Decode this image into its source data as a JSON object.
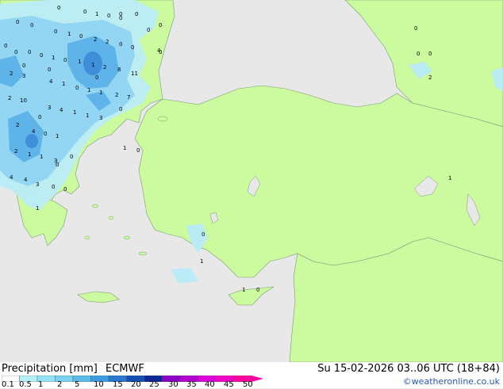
{
  "footer": {
    "title": "Precipitation [mm]",
    "model": "ECMWF",
    "datetime": "Su 15-02-2026 03..06 UTC (18+84)",
    "credit": "©weatheronline.co.uk"
  },
  "scale": {
    "ticks": [
      "0.1",
      "0.5",
      "1",
      "2",
      "5",
      "10",
      "15",
      "20",
      "25",
      "30",
      "35",
      "40",
      "45",
      "50"
    ],
    "colors": [
      "#ffffff",
      "#b4f0f8",
      "#96e2f5",
      "#78d2f0",
      "#5abbe8",
      "#3c9ee0",
      "#2878d2",
      "#1450b4",
      "#0a2896",
      "#8c00c8",
      "#b400d2",
      "#dc00dc",
      "#f000c8",
      "#ff00a0"
    ]
  },
  "colors": {
    "land": "#ccfa9e",
    "sea": "#e8e8e8",
    "border": "#7a9a7a",
    "light_rain": "#b9ecf7",
    "medium_rain": "#8fd5f2",
    "heavy_rain": "#5cb2e8"
  },
  "map_values": [
    "0",
    "0",
    "1",
    "0",
    "0",
    "0",
    "0",
    "0",
    "0",
    "0",
    "1",
    "0",
    "2",
    "2",
    "0",
    "0",
    "4",
    "0",
    "0",
    "0",
    "0",
    "0",
    "1",
    "0",
    "2",
    "3",
    "1",
    "1",
    "2",
    "8",
    "11",
    "2",
    "4",
    "1",
    "0",
    "1",
    "1",
    "2",
    "7",
    "2",
    "10",
    "3",
    "4",
    "1",
    "1",
    "3",
    "2",
    "4",
    "0",
    "1",
    "1",
    "0",
    "2",
    "1",
    "1",
    "3",
    "4",
    "4",
    "3",
    "0",
    "0",
    "1",
    "0",
    "1",
    "1",
    "0",
    "1",
    "0",
    "0",
    "0",
    "0",
    "0",
    "0",
    "0",
    "0",
    "0",
    "0",
    "0",
    "0"
  ]
}
